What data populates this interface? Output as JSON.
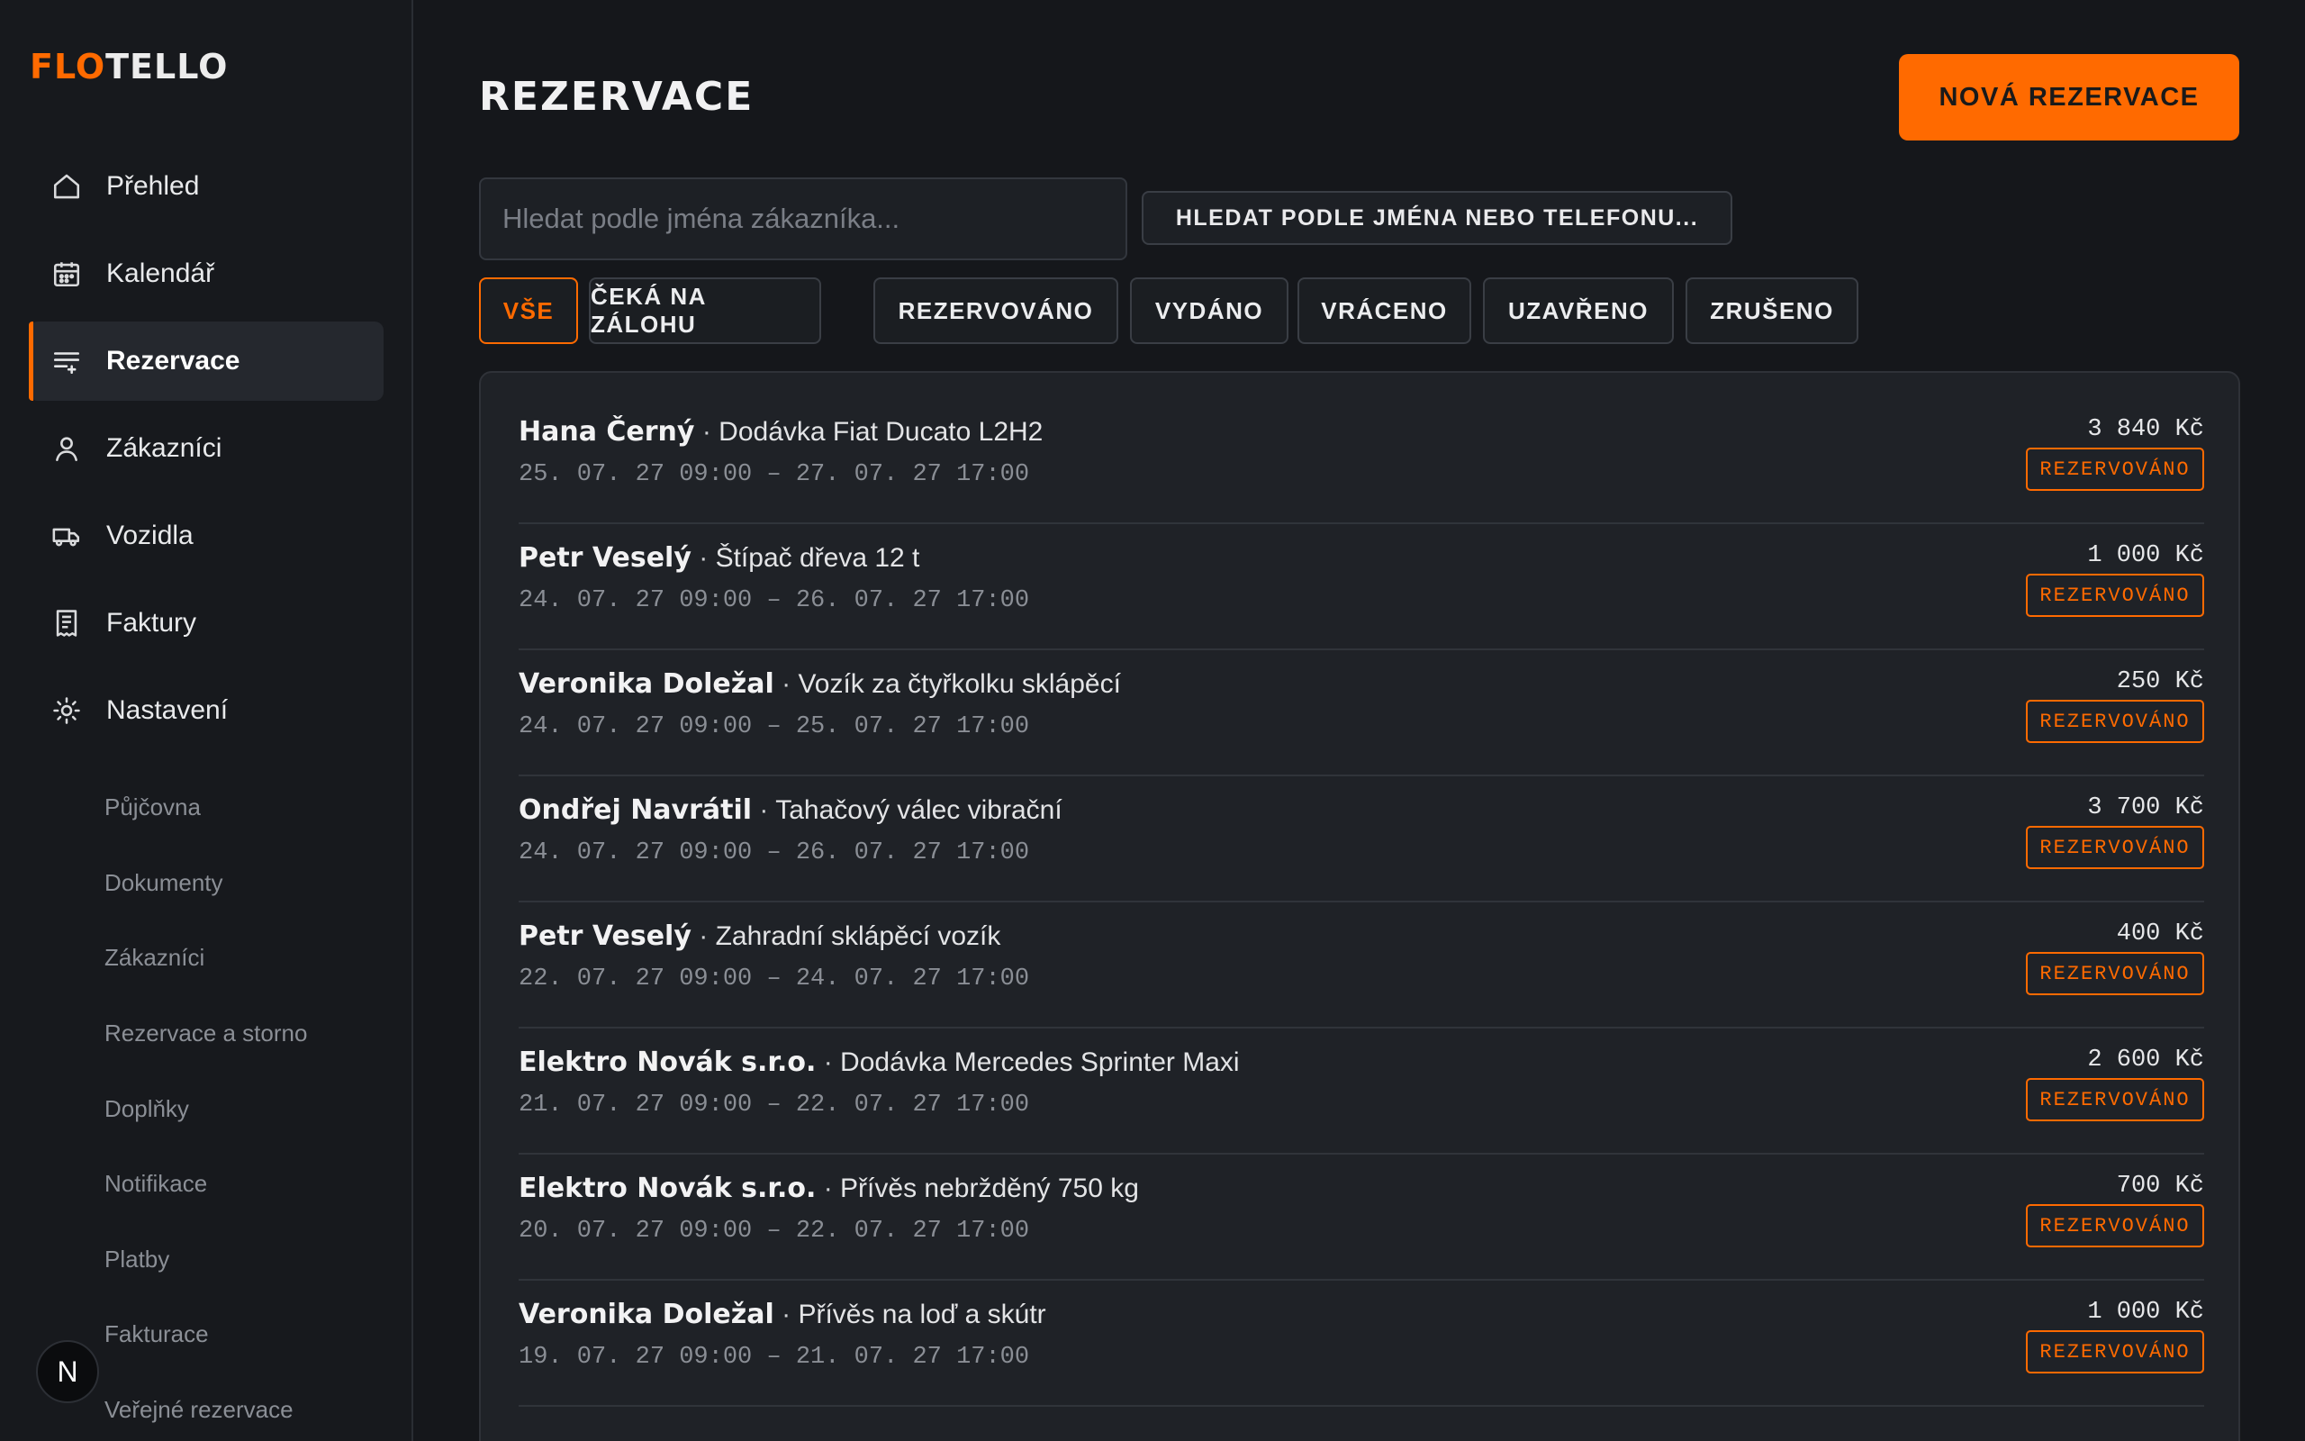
{
  "brand": {
    "part1": "FLO",
    "part2": "TELLO",
    "accent": "#ff6a00"
  },
  "sidebar": {
    "nav": [
      {
        "label": "Přehled",
        "icon": "home-icon"
      },
      {
        "label": "Kalendář",
        "icon": "calendar-icon"
      },
      {
        "label": "Rezervace",
        "icon": "list-icon",
        "active": true
      },
      {
        "label": "Zákazníci",
        "icon": "user-icon"
      },
      {
        "label": "Vozidla",
        "icon": "truck-icon"
      },
      {
        "label": "Faktury",
        "icon": "receipt-icon"
      },
      {
        "label": "Nastavení",
        "icon": "gear-icon"
      }
    ],
    "sub": [
      "Půjčovna",
      "Dokumenty",
      "Zákazníci",
      "Rezervace a storno",
      "Doplňky",
      "Notifikace",
      "Platby",
      "Fakturace",
      "Veřejné rezervace"
    ],
    "avatar_letter": "N"
  },
  "main": {
    "title": "REZERVACE",
    "new_button": "NOVÁ REZERVACE",
    "search_placeholder": "Hledat podle jména zákazníka...",
    "search_button": "HLEDAT PODLE JMÉNA NEBO TELEFONU...",
    "filters": [
      "VŠE",
      "ČEKÁ NA ZÁLOHU",
      "REZERVOVÁNO",
      "VYDÁNO",
      "VRÁCENO",
      "UZAVŘENO",
      "ZRUŠENO"
    ],
    "active_filter": "VŠE"
  },
  "reservations": [
    {
      "customer": "Hana Černý",
      "item": "Dodávka Fiat Ducato L2H2",
      "dates": "25. 07. 27 09:00 – 27. 07. 27 17:00",
      "price": "3 840 Kč",
      "status": "REZERVOVÁNO"
    },
    {
      "customer": "Petr Veselý",
      "item": "Štípač dřeva 12 t",
      "dates": "24. 07. 27 09:00 – 26. 07. 27 17:00",
      "price": "1 000 Kč",
      "status": "REZERVOVÁNO"
    },
    {
      "customer": "Veronika Doležal",
      "item": "Vozík za čtyřkolku sklápěcí",
      "dates": "24. 07. 27 09:00 – 25. 07. 27 17:00",
      "price": "250 Kč",
      "status": "REZERVOVÁNO"
    },
    {
      "customer": "Ondřej Navrátil",
      "item": "Tahačový válec vibrační",
      "dates": "24. 07. 27 09:00 – 26. 07. 27 17:00",
      "price": "3 700 Kč",
      "status": "REZERVOVÁNO"
    },
    {
      "customer": "Petr Veselý",
      "item": "Zahradní sklápěcí vozík",
      "dates": "22. 07. 27 09:00 – 24. 07. 27 17:00",
      "price": "400 Kč",
      "status": "REZERVOVÁNO"
    },
    {
      "customer": "Elektro Novák s.r.o.",
      "item": "Dodávka Mercedes Sprinter Maxi",
      "dates": "21. 07. 27 09:00 – 22. 07. 27 17:00",
      "price": "2 600 Kč",
      "status": "REZERVOVÁNO"
    },
    {
      "customer": "Elektro Novák s.r.o.",
      "item": "Přívěs nebržděný 750 kg",
      "dates": "20. 07. 27 09:00 – 22. 07. 27 17:00",
      "price": "700 Kč",
      "status": "REZERVOVÁNO"
    },
    {
      "customer": "Veronika Doležal",
      "item": "Přívěs na loď a skútr",
      "dates": "19. 07. 27 09:00 – 21. 07. 27 17:00",
      "price": "1 000 Kč",
      "status": "REZERVOVÁNO"
    }
  ],
  "separator": "·"
}
